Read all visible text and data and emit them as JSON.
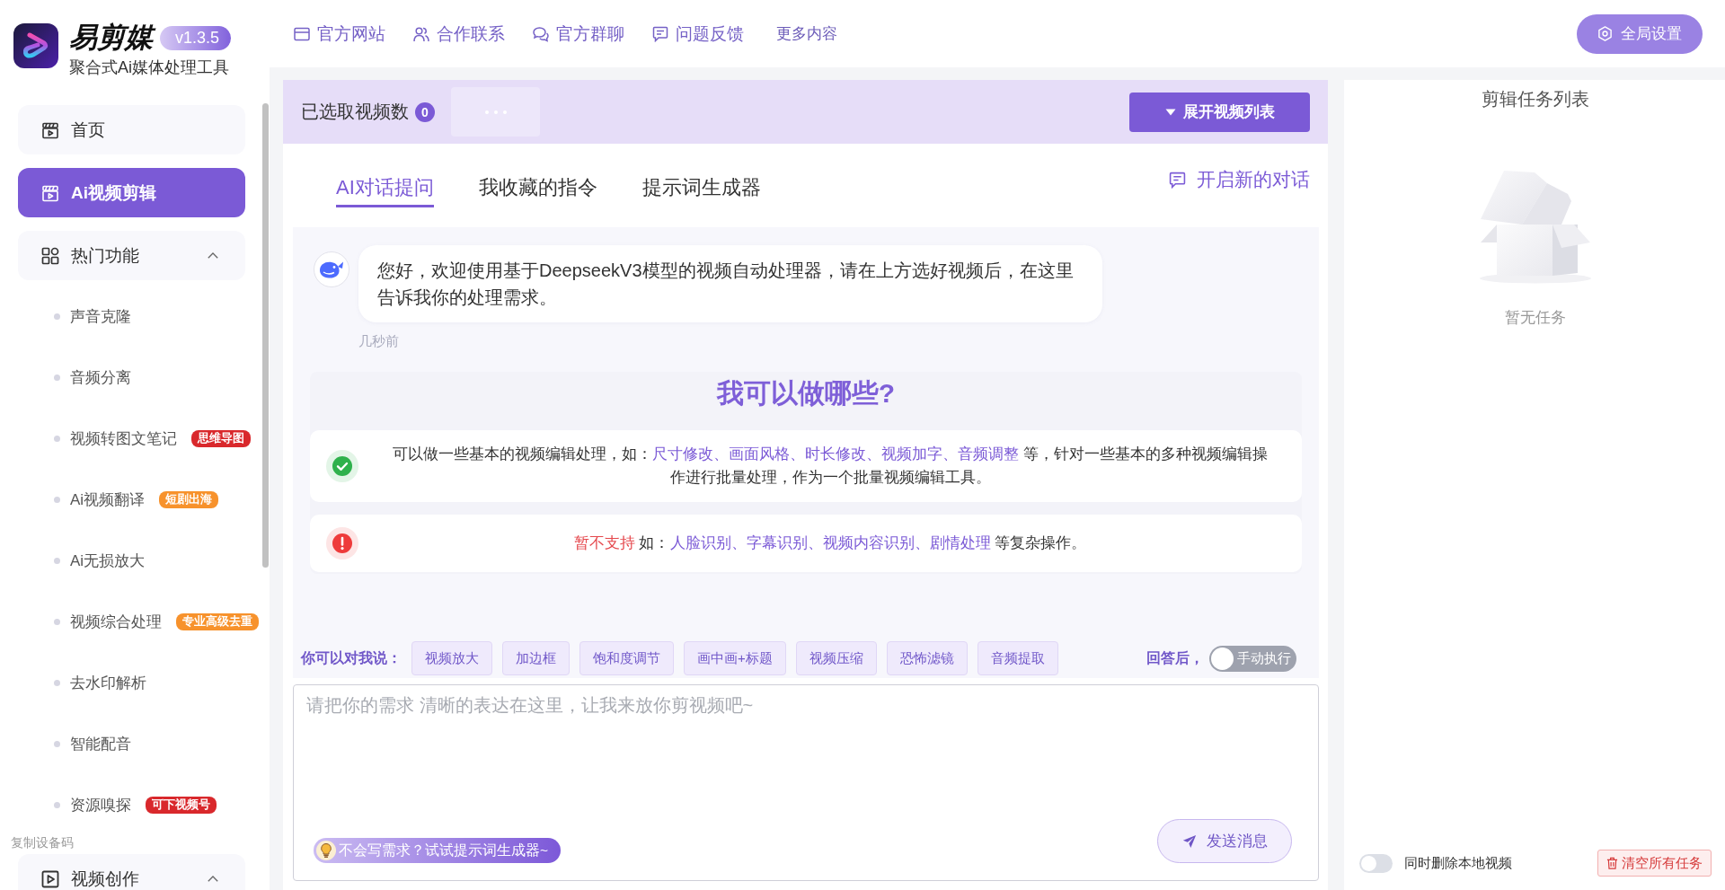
{
  "app": {
    "name": "易剪媒",
    "version": "v1.3.5",
    "tagline": "聚合式Ai媒体处理工具"
  },
  "sidebar": {
    "items": [
      {
        "kind": "page",
        "label": "首页",
        "selected": false
      },
      {
        "kind": "page",
        "label": "Ai视频剪辑",
        "selected": true
      },
      {
        "kind": "group",
        "label": "热门功能",
        "expanded": true,
        "children": [
          {
            "label": "声音克隆",
            "selected": false
          },
          {
            "label": "音频分离",
            "selected": false
          },
          {
            "label": "视频转图文笔记",
            "selected": false,
            "badge": {
              "text": "思维导图",
              "color": "#d9282c"
            }
          },
          {
            "label": "Ai视频翻译",
            "selected": false,
            "badge": {
              "text": "短剧出海",
              "color": "#f7922c"
            }
          },
          {
            "label": "Ai无损放大",
            "selected": false
          },
          {
            "label": "视频综合处理",
            "selected": false,
            "badge": {
              "text": "专业高级去重",
              "color": "#f7922c"
            }
          },
          {
            "label": "去水印解析",
            "selected": false
          },
          {
            "label": "智能配音",
            "selected": false
          },
          {
            "label": "资源嗅探",
            "selected": false,
            "badge": {
              "text": "可下视频号",
              "color": "#d9282c"
            }
          }
        ]
      },
      {
        "kind": "group",
        "label": "视频创作",
        "expanded": true
      }
    ],
    "device_code_link": "复制设备码"
  },
  "topbar": {
    "links": [
      {
        "kind": "icon",
        "label": "官方网站"
      },
      {
        "kind": "icon",
        "label": "合作联系"
      },
      {
        "kind": "icon",
        "label": "官方群聊"
      },
      {
        "kind": "icon",
        "label": "问题反馈"
      },
      {
        "kind": "plain",
        "label": "更多内容"
      }
    ],
    "settings_button": "全局设置"
  },
  "selection_bar": {
    "label": "已选取视频数",
    "count": "0",
    "expand_button": "展开视频列表"
  },
  "tabs": [
    {
      "label": "AI对话提问",
      "selected": true
    },
    {
      "label": "我收藏的指令",
      "selected": false
    },
    {
      "label": "提示词生成器",
      "selected": false
    }
  ],
  "new_chat_link": "开启新的对话",
  "messages": [
    {
      "text": "您好，欢迎使用基于DeepseekV3模型的视频自动处理器，请在上方选好视频后，在这里告诉我你的处理需求。",
      "time": "几秒前"
    }
  ],
  "capabilities": {
    "title": "我可以做哪些?",
    "items": [
      {
        "kind": "supported",
        "segments": [
          {
            "kind": "plain",
            "text": "可以做一些基本的视频编辑处理，如："
          },
          {
            "kind": "keyword",
            "text": "尺寸修改、画面风格、时长修改、视频加字、音频调整"
          },
          {
            "kind": "plain",
            "text": " 等，针对一些基本的多种视频编辑操作进行批量处理，作为一个批量视频编辑工具。"
          }
        ]
      },
      {
        "kind": "unsupported",
        "segments": [
          {
            "kind": "warning",
            "text": "暂不支持"
          },
          {
            "kind": "plain",
            "text": " 如："
          },
          {
            "kind": "keyword",
            "text": "人脸识别、字幕识别、视频内容识别、剧情处理"
          },
          {
            "kind": "plain",
            "text": " 等复杂操作。"
          }
        ]
      }
    ]
  },
  "suggestions": {
    "label": "你可以对我说：",
    "chips": [
      "视频放大",
      "加边框",
      "饱和度调节",
      "画中画+标题",
      "视频压缩",
      "恐怖滤镜",
      "音频提取"
    ]
  },
  "after_answer": {
    "label": "回答后，",
    "toggle": {
      "on": false,
      "text": "手动执行"
    }
  },
  "composer": {
    "placeholder": "请把你的需求 清晰的表达在这里，让我来放你剪视频吧~",
    "helper_link": "不会写需求？试试提示词生成器~",
    "send_button": "发送消息"
  },
  "task_panel": {
    "title": "剪辑任务列表",
    "empty_text": "暂无任务",
    "delete_local": {
      "label": "同时删除本地视频",
      "on": false
    },
    "clear_button": "清空所有任务"
  }
}
